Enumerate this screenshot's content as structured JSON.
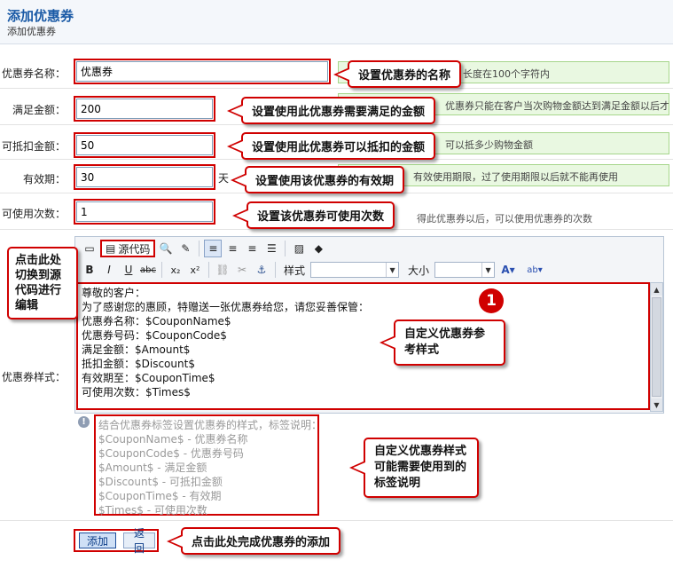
{
  "header": {
    "title": "添加优惠券",
    "subtitle": "添加优惠券"
  },
  "fields": {
    "name": {
      "label": "优惠券名称：",
      "value": "优惠券",
      "hint": "长度在100个字符内"
    },
    "amount": {
      "label": "满足金额：",
      "value": "200",
      "hint": "优惠券只能在客户当次购物金额达到满足金额以后才"
    },
    "discount": {
      "label": "可抵扣金额：",
      "value": "50",
      "hint": "可以抵多少购物金额"
    },
    "validity": {
      "label": "有效期：",
      "value": "30",
      "unit": "天",
      "hint": "有效使用期限，过了使用期限以后就不能再使用"
    },
    "times": {
      "label": "可使用次数：",
      "value": "1",
      "hint": "得此优惠券以后，可以使用优惠券的次数"
    },
    "style": {
      "label": "优惠券样式："
    }
  },
  "editor": {
    "source_label": "源代码",
    "style_label": "样式",
    "size_label": "大小",
    "toolbar_icons": [
      "fullscreen-icon",
      "source-icon",
      "find-icon",
      "eraser-icon",
      "align-left-icon",
      "align-center-icon",
      "align-right-icon",
      "justify-icon",
      "image-icon",
      "flash-icon",
      "bold-icon",
      "italic-icon",
      "underline-icon",
      "strikethrough-icon",
      "subscript-icon",
      "superscript-icon",
      "link-icon",
      "unlink-icon",
      "anchor-icon",
      "font-color-icon",
      "highlight-icon"
    ],
    "lines": [
      "尊敬的客户：",
      "为了感谢您的惠顾，特赠送一张优惠券给您，请您妥善保管：",
      "优惠券名称：$CouponName$",
      "优惠券号码：$CouponCode$",
      "满足金额：$Amount$",
      "抵扣金额：$Discount$",
      "有效期至：$CouponTime$",
      "可使用次数：$Times$"
    ]
  },
  "tag_help": {
    "lines": [
      "结合优惠券标签设置优惠券的样式，标签说明：",
      "$CouponName$ - 优惠券名称",
      "$CouponCode$ - 优惠券号码",
      "$Amount$ - 满足金额",
      "$Discount$ - 可抵扣金额",
      "$CouponTime$ - 有效期",
      "$Times$ - 可使用次数"
    ]
  },
  "buttons": {
    "add": "添加",
    "back": "返回"
  },
  "callouts": {
    "name": "设置优惠券的名称",
    "amount": "设置使用此优惠券需要满足的金额",
    "discount": "设置使用此优惠券可以抵扣的金额",
    "validity": "设置使用该优惠券的有效期",
    "times": "设置该优惠券可使用次数",
    "source": "点击此处切换到源代码进行编辑",
    "style": "自定义优惠券参考样式",
    "tags": "自定义优惠券样式可能需要使用到的标签说明",
    "submit": "点击此处完成优惠券的添加"
  },
  "badge": "1",
  "colors": {
    "accent": "#d00000",
    "title": "#1a5aa6",
    "hint_bg": "#e9f8e1"
  }
}
